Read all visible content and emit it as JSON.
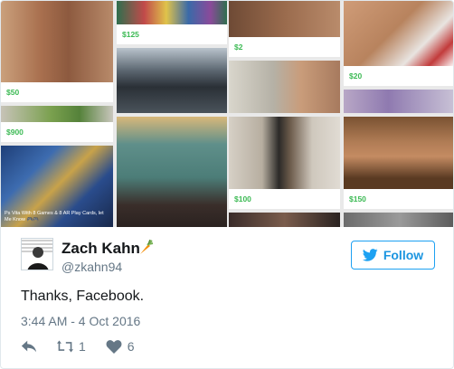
{
  "mosaic": {
    "tiles": [
      {
        "price": "$50"
      },
      {
        "price": "$125"
      },
      {
        "price": "$2"
      },
      {
        "price": "$20"
      },
      {
        "price": "$900"
      },
      {
        "price": "$100"
      },
      {
        "price": "$150"
      }
    ],
    "caption": "Ps Vita With 8 Games & 8 AR Play Cards, let Me Know 🎮🎮"
  },
  "user": {
    "display_name": "Zach Kahn",
    "handle": "@zkahn94",
    "badge_icon": "carrot-emoji"
  },
  "follow": {
    "label": "Follow",
    "icon": "twitter-bird-icon",
    "color": "#1b95e0"
  },
  "tweet": {
    "text": "Thanks, Facebook.",
    "timestamp": "3:44 AM - 4 Oct 2016"
  },
  "actions": {
    "reply_icon": "reply-icon",
    "retweet_icon": "retweet-icon",
    "retweet_count": "1",
    "like_icon": "heart-icon",
    "like_count": "6"
  },
  "colors": {
    "price_green": "#3cba54",
    "twitter_blue": "#1da1f2",
    "muted_text": "#657786"
  }
}
